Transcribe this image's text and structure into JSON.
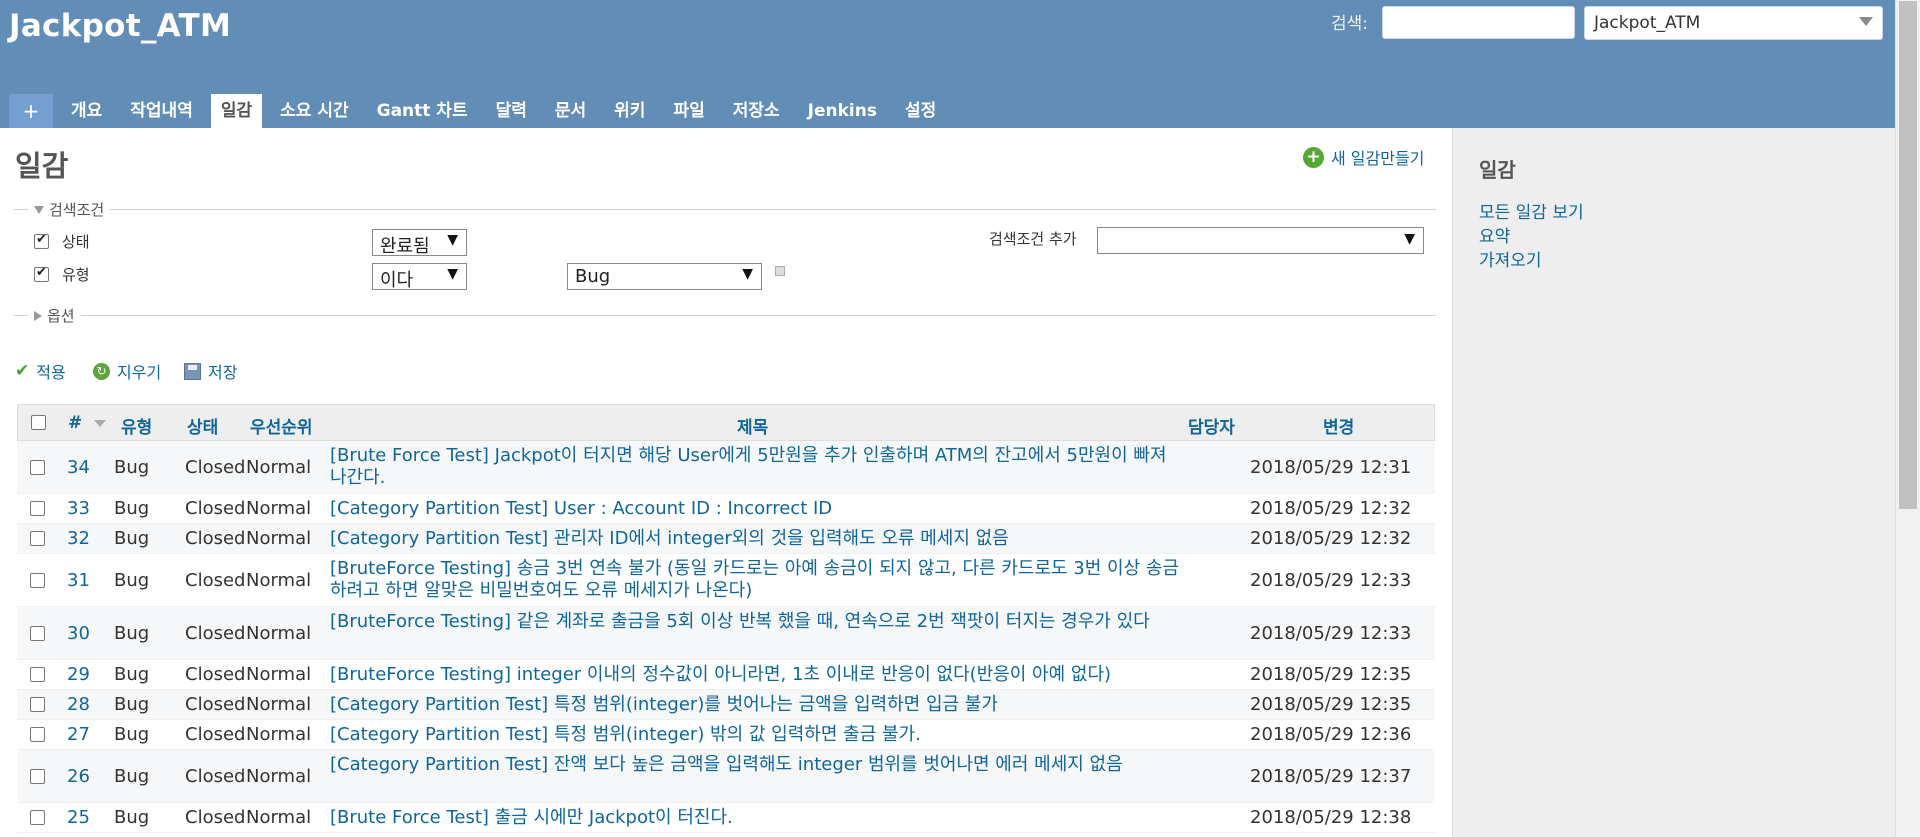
{
  "header": {
    "project_title": "Jackpot_ATM",
    "search_label": "검색:",
    "search_placeholder": "",
    "project_select_value": "Jackpot_ATM",
    "bg_color": "#628db6"
  },
  "menu": {
    "plus_label": "+",
    "tabs": [
      "개요",
      "작업내역",
      "일감",
      "소요 시간",
      "Gantt 차트",
      "달력",
      "문서",
      "위키",
      "파일",
      "저장소",
      "Jenkins",
      "설정"
    ],
    "selected": "일감"
  },
  "main": {
    "title": "일감",
    "new_issue_label": "새 일감만들기",
    "filters": {
      "legend": "검색조건",
      "rows": [
        {
          "label": "상태",
          "operator": "완료됨"
        },
        {
          "label": "유형",
          "operator": "이다",
          "value": "Bug"
        }
      ],
      "add_filter_label": "검색조건 추가",
      "add_filter_value": ""
    },
    "options_legend": "옵션",
    "actions": {
      "apply": "적용",
      "clear": "지우기",
      "save": "저장"
    }
  },
  "table": {
    "headers": {
      "id": "#",
      "tracker": "유형",
      "status": "상태",
      "priority": "우선순위",
      "subject": "제목",
      "assignee": "담당자",
      "updated": "변경"
    },
    "rows": [
      {
        "id": "34",
        "tracker": "Bug",
        "status": "Closed",
        "priority": "Normal",
        "subject": "[Brute Force Test] Jackpot이 터지면 해당 User에게 5만원을 추가 인출하며 ATM의 잔고에서 5만원이 빠져나간다.",
        "updated": "2018/05/29 12:31"
      },
      {
        "id": "33",
        "tracker": "Bug",
        "status": "Closed",
        "priority": "Normal",
        "subject": "[Category Partition Test] User : Account ID : Incorrect ID",
        "updated": "2018/05/29 12:32"
      },
      {
        "id": "32",
        "tracker": "Bug",
        "status": "Closed",
        "priority": "Normal",
        "subject": "[Category Partition Test] 관리자 ID에서 integer외의 것을 입력해도 오류 메세지 없음",
        "updated": "2018/05/29 12:32"
      },
      {
        "id": "31",
        "tracker": "Bug",
        "status": "Closed",
        "priority": "Normal",
        "subject": "[BruteForce Testing] 송금 3번 연속 불가 (동일 카드로는 아예 송금이 되지 않고, 다른 카드로도 3번 이상 송금 하려고 하면 알맞은 비밀번호여도 오류 메세지가 나온다)",
        "updated": "2018/05/29 12:33"
      },
      {
        "id": "30",
        "tracker": "Bug",
        "status": "Closed",
        "priority": "Normal",
        "subject": "[BruteForce Testing] 같은 계좌로 출금을 5회 이상 반복 했을 때, 연속으로 2번 잭팟이 터지는 경우가 있다",
        "updated": "2018/05/29 12:33"
      },
      {
        "id": "29",
        "tracker": "Bug",
        "status": "Closed",
        "priority": "Normal",
        "subject": "[BruteForce Testing] integer 이내의 정수값이 아니라면, 1초 이내로 반응이 없다(반응이 아예 없다)",
        "updated": "2018/05/29 12:35"
      },
      {
        "id": "28",
        "tracker": "Bug",
        "status": "Closed",
        "priority": "Normal",
        "subject": "[Category Partition Test] 특정 범위(integer)를 벗어나는 금액을 입력하면 입금 불가",
        "updated": "2018/05/29 12:35"
      },
      {
        "id": "27",
        "tracker": "Bug",
        "status": "Closed",
        "priority": "Normal",
        "subject": "[Category Partition Test] 특정 범위(integer) 밖의 값 입력하면 출금 불가.",
        "updated": "2018/05/29 12:36"
      },
      {
        "id": "26",
        "tracker": "Bug",
        "status": "Closed",
        "priority": "Normal",
        "subject": "[Category Partition Test] 잔액 보다 높은 금액을 입력해도 integer 범위를 벗어나면 에러 메세지 없음",
        "updated": "2018/05/29 12:37"
      },
      {
        "id": "25",
        "tracker": "Bug",
        "status": "Closed",
        "priority": "Normal",
        "subject": "[Brute Force Test] 출금 시에만 Jackpot이 터진다.",
        "updated": "2018/05/29 12:38"
      }
    ]
  },
  "sidebar": {
    "title": "일감",
    "links": [
      "모든 일감 보기",
      "요약",
      "가져오기"
    ]
  }
}
